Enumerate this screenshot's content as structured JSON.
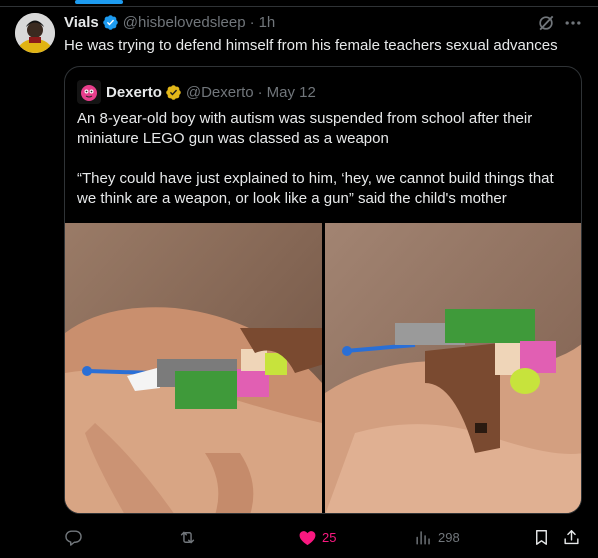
{
  "tweet": {
    "author_name": "Vials",
    "author_handle": "@hisbelovedsleep",
    "separator": "·",
    "time": "1h",
    "text": "He was trying to defend himself from his female teachers sexual advances"
  },
  "quoted": {
    "author_name": "Dexerto",
    "author_handle": "@Dexerto",
    "separator": "·",
    "date": "May 12",
    "paragraph_1": "An 8-year-old boy with autism was suspended from school after their miniature LEGO gun was classed as a weapon",
    "paragraph_2": "“They could have just explained to him, ‘hey, we cannot build things that we think are a weapon, or look like a gun” said the child's mother"
  },
  "actions": {
    "replies": "",
    "reposts": "",
    "likes": "25",
    "views": "298"
  },
  "colors": {
    "background": "#000000",
    "text": "#e7e9ea",
    "muted": "#71767b",
    "border": "#2f3336",
    "verified_blue": "#1d9bf0",
    "verified_gold": "#e2b719",
    "like_pink": "#f91880"
  },
  "icons": {
    "verified": "verified-badge-icon",
    "gold_verified": "gold-verified-badge-icon",
    "grok": "grok-icon",
    "more": "more-icon",
    "reply": "reply-icon",
    "repost": "repost-icon",
    "like": "heart-icon",
    "views": "views-icon",
    "bookmark": "bookmark-icon",
    "share": "share-icon"
  }
}
